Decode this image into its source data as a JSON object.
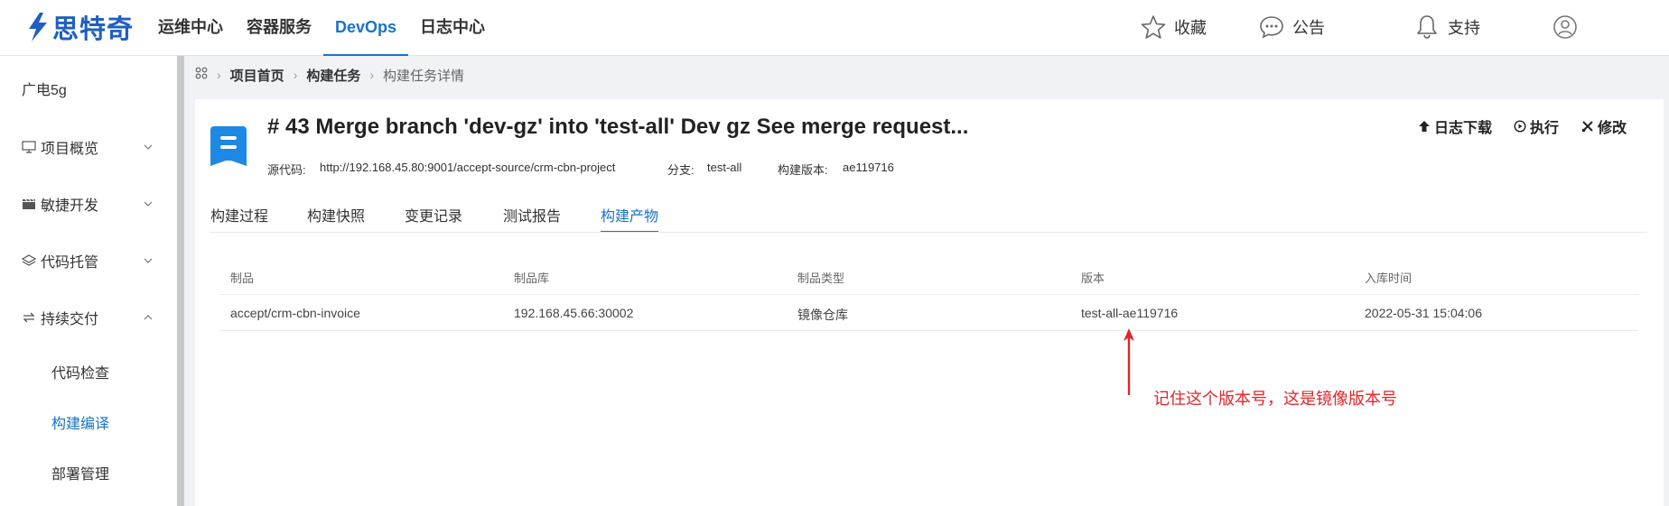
{
  "header": {
    "logo_text": "思特奇",
    "nav": [
      "运维中心",
      "容器服务",
      "DevOps",
      "日志中心"
    ],
    "active_nav": "DevOps",
    "favorites": "收藏",
    "announcements": "公告",
    "support": "支持"
  },
  "sidebar": {
    "project": "广电5g",
    "menu": [
      {
        "label": "项目概览",
        "icon": "monitor-icon",
        "expanded": false
      },
      {
        "label": "敏捷开发",
        "icon": "clapper-icon",
        "expanded": false
      },
      {
        "label": "代码托管",
        "icon": "layers-icon",
        "expanded": false
      },
      {
        "label": "持续交付",
        "icon": "sync-icon",
        "expanded": true
      }
    ],
    "submenu": [
      "代码检查",
      "构建编译",
      "部署管理"
    ],
    "active_submenu": "构建编译"
  },
  "breadcrumb": {
    "items": [
      "项目首页",
      "构建任务",
      "构建任务详情"
    ]
  },
  "build": {
    "title": "# 43 Merge branch 'dev-gz' into 'test-all' Dev gz See merge request...",
    "source_label": "源代码:",
    "source_value": "http://192.168.45.80:9001/accept-source/crm-cbn-project",
    "branch_label": "分支:",
    "branch_value": "test-all",
    "version_label": "构建版本:",
    "version_value": "ae119716"
  },
  "actions": {
    "download_log": "日志下载",
    "execute": "执行",
    "edit": "修改"
  },
  "tabs": [
    "构建过程",
    "构建快照",
    "变更记录",
    "测试报告",
    "构建产物"
  ],
  "active_tab": "构建产物",
  "table": {
    "headers": [
      "制品",
      "制品库",
      "制品类型",
      "版本",
      "入库时间"
    ],
    "rows": [
      [
        "accept/crm-cbn-invoice",
        "192.168.45.66:30002",
        "镜像仓库",
        "test-all-ae119716",
        "2022-05-31 15:04:06"
      ]
    ]
  },
  "annotation": {
    "text": "记住这个版本号，这是镜像版本号",
    "color": "#e0262b"
  },
  "colors": {
    "brand": "#1f5fc2",
    "accent": "#1a73c9"
  }
}
